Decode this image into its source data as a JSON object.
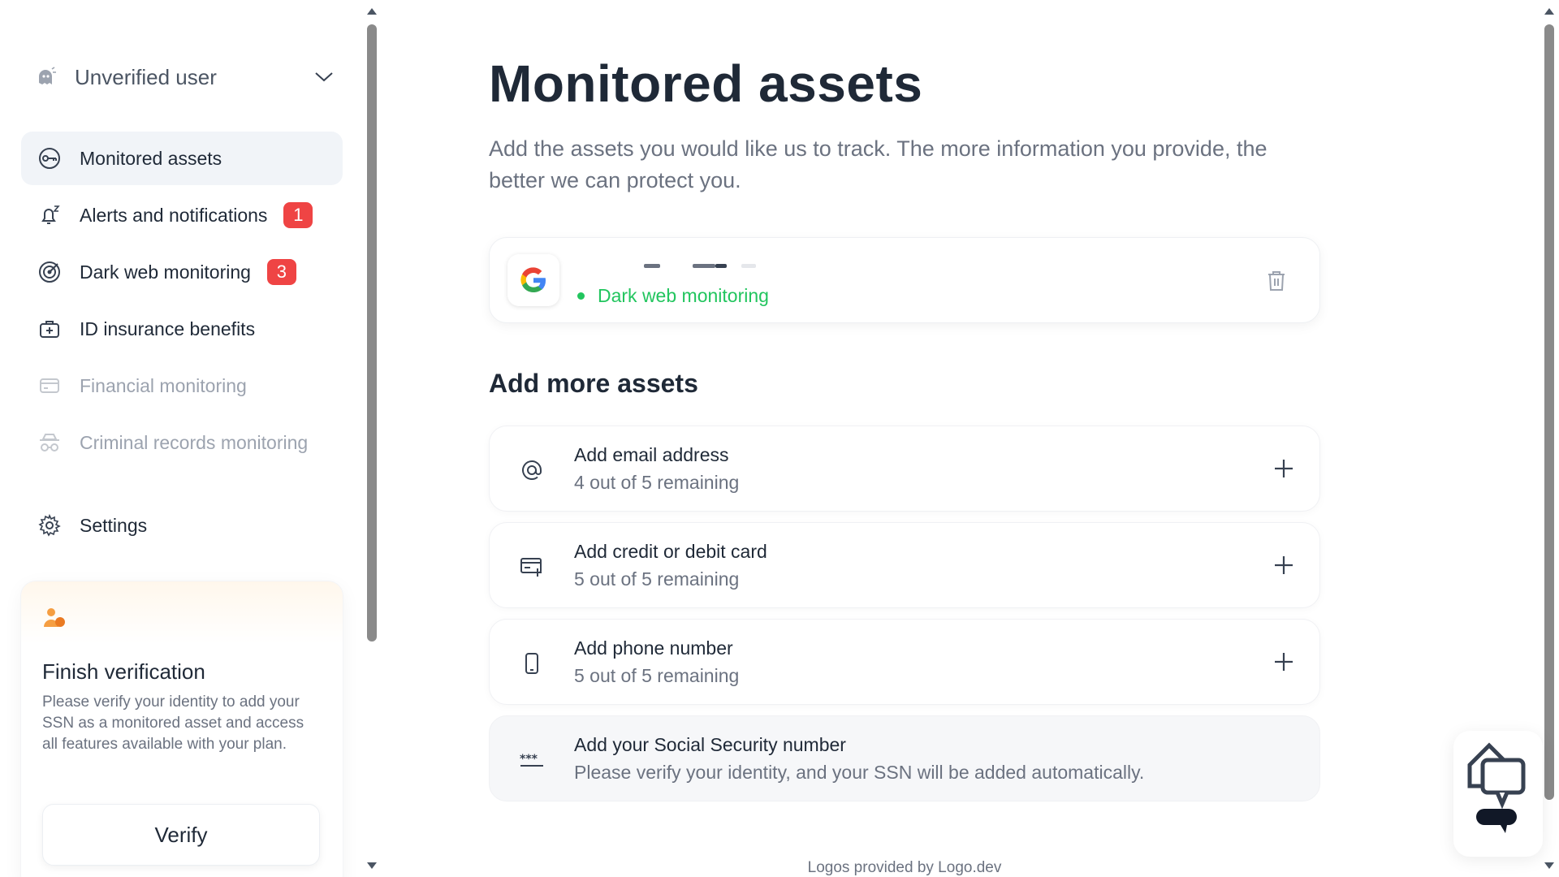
{
  "sidebar": {
    "user_label": "Unverified user",
    "nav": [
      {
        "label": "Monitored assets",
        "icon": "key-icon",
        "active": true
      },
      {
        "label": "Alerts and notifications",
        "icon": "bell-icon",
        "badge": "1"
      },
      {
        "label": "Dark web monitoring",
        "icon": "target-icon",
        "badge": "3"
      },
      {
        "label": "ID insurance benefits",
        "icon": "briefcase-icon"
      },
      {
        "label": "Financial monitoring",
        "icon": "card-icon",
        "disabled": true
      },
      {
        "label": "Criminal records monitoring",
        "icon": "spy-icon",
        "disabled": true
      }
    ],
    "settings_label": "Settings",
    "verify": {
      "title": "Finish verification",
      "text": "Please verify your identity to add your SSN as a monitored asset and access all features available with your plan.",
      "button": "Verify"
    }
  },
  "main": {
    "title": "Monitored assets",
    "subtitle": "Add the assets you would like us to track. The more information you provide, the better we can protect you.",
    "asset": {
      "logo": "G",
      "status": "Dark web monitoring"
    },
    "add_more_title": "Add more assets",
    "add_items": [
      {
        "title": "Add email address",
        "subtitle": "4 out of 5 remaining",
        "icon": "at-icon"
      },
      {
        "title": "Add credit or debit card",
        "subtitle": "5 out of 5 remaining",
        "icon": "card-add-icon"
      },
      {
        "title": "Add phone number",
        "subtitle": "5 out of 5 remaining",
        "icon": "phone-icon"
      },
      {
        "title": "Add your Social Security number",
        "subtitle": "Please verify your identity, and your SSN will be added automatically.",
        "icon": "ssn-icon"
      }
    ],
    "footer": "Logos provided by Logo.dev"
  },
  "colors": {
    "badge": "#ef4444",
    "status_green": "#22c55e",
    "active_bg": "#f1f4f8"
  }
}
